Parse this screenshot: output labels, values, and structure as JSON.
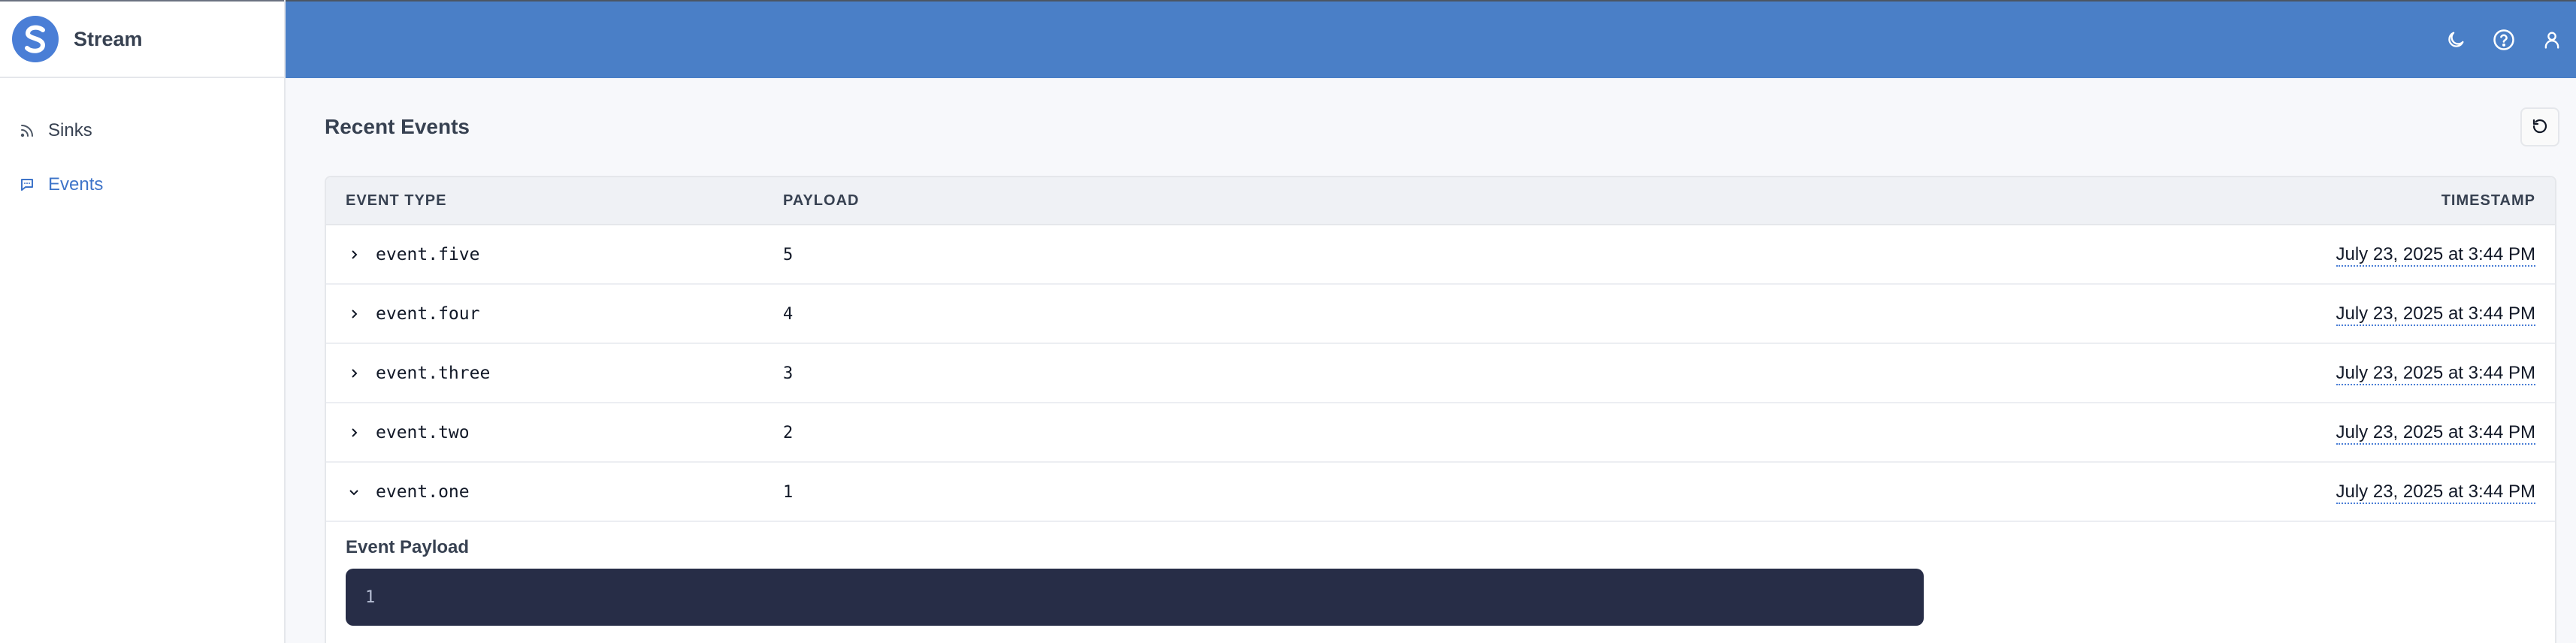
{
  "app": {
    "name": "Stream"
  },
  "sidebar": {
    "items": [
      {
        "label": "Sinks",
        "icon": "rss-icon",
        "active": false
      },
      {
        "label": "Events",
        "icon": "message-icon",
        "active": true
      }
    ]
  },
  "topbar": {
    "icons": [
      "moon-icon",
      "help-circle-icon",
      "user-icon"
    ]
  },
  "section": {
    "title": "Recent Events"
  },
  "table": {
    "headers": {
      "event_type": "EVENT TYPE",
      "payload": "PAYLOAD",
      "timestamp": "TIMESTAMP"
    },
    "rows": [
      {
        "event_type": "event.five",
        "payload": "5",
        "timestamp": "July 23, 2025 at 3:44 PM",
        "expanded": false
      },
      {
        "event_type": "event.four",
        "payload": "4",
        "timestamp": "July 23, 2025 at 3:44 PM",
        "expanded": false
      },
      {
        "event_type": "event.three",
        "payload": "3",
        "timestamp": "July 23, 2025 at 3:44 PM",
        "expanded": false
      },
      {
        "event_type": "event.two",
        "payload": "2",
        "timestamp": "July 23, 2025 at 3:44 PM",
        "expanded": false
      },
      {
        "event_type": "event.one",
        "payload": "1",
        "timestamp": "July 23, 2025 at 3:44 PM",
        "expanded": true
      }
    ],
    "expanded_panel": {
      "label": "Event Payload",
      "code": "1"
    }
  },
  "colors": {
    "accent": "#4a7ed6",
    "topbar": "#4a7fc7",
    "code_bg": "#272d47"
  }
}
